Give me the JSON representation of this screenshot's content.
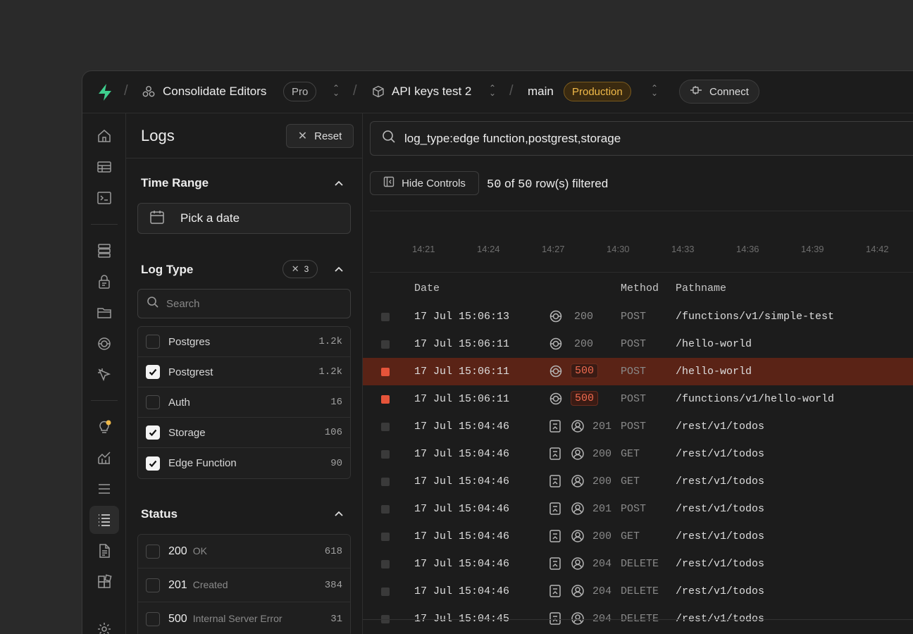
{
  "topbar": {
    "org_name": "Consolidate Editors",
    "plan": "Pro",
    "project_name": "API keys test 2",
    "branch": "main",
    "env": "Production",
    "connect_label": "Connect"
  },
  "panel": {
    "title": "Logs",
    "reset_label": "Reset",
    "time_range_title": "Time Range",
    "date_placeholder": "Pick a date",
    "log_type_title": "Log Type",
    "log_type_selected_count": "3",
    "search_placeholder": "Search",
    "log_types": [
      {
        "label": "Postgres",
        "count": "1.2k",
        "checked": false
      },
      {
        "label": "Postgrest",
        "count": "1.2k",
        "checked": true
      },
      {
        "label": "Auth",
        "count": "16",
        "checked": false
      },
      {
        "label": "Storage",
        "count": "106",
        "checked": true
      },
      {
        "label": "Edge Function",
        "count": "90",
        "checked": true
      }
    ],
    "status_title": "Status",
    "statuses": [
      {
        "code": "200",
        "desc": "OK",
        "count": "618"
      },
      {
        "code": "201",
        "desc": "Created",
        "count": "384"
      },
      {
        "code": "500",
        "desc": "Internal Server Error",
        "count": "31"
      }
    ]
  },
  "main": {
    "query": "log_type:edge function,postgrest,storage",
    "hide_controls_label": "Hide Controls",
    "filtered_count": "50",
    "filtered_total": "50",
    "filtered_of": "of",
    "filtered_suffix": "row(s) filtered",
    "timeline_ticks": [
      "14:21",
      "14:24",
      "14:27",
      "14:30",
      "14:33",
      "14:36",
      "14:39",
      "14:42"
    ],
    "columns": {
      "date": "Date",
      "method": "Method",
      "pathname": "Pathname"
    },
    "rows": [
      {
        "date": "17 Jul 15:06:13",
        "type": "edge",
        "status": "200",
        "method": "POST",
        "path": "/functions/v1/simple-test",
        "level": "ok"
      },
      {
        "date": "17 Jul 15:06:11",
        "type": "edge",
        "status": "200",
        "method": "POST",
        "path": "/hello-world",
        "level": "ok"
      },
      {
        "date": "17 Jul 15:06:11",
        "type": "edge",
        "status": "500",
        "method": "POST",
        "path": "/hello-world",
        "level": "error-selected"
      },
      {
        "date": "17 Jul 15:06:11",
        "type": "edge",
        "status": "500",
        "method": "POST",
        "path": "/functions/v1/hello-world",
        "level": "error"
      },
      {
        "date": "17 Jul 15:04:46",
        "type": "rest",
        "status": "201",
        "method": "POST",
        "path": "/rest/v1/todos",
        "level": "ok"
      },
      {
        "date": "17 Jul 15:04:46",
        "type": "rest",
        "status": "200",
        "method": "GET",
        "path": "/rest/v1/todos",
        "level": "ok"
      },
      {
        "date": "17 Jul 15:04:46",
        "type": "rest",
        "status": "200",
        "method": "GET",
        "path": "/rest/v1/todos",
        "level": "ok"
      },
      {
        "date": "17 Jul 15:04:46",
        "type": "rest",
        "status": "201",
        "method": "POST",
        "path": "/rest/v1/todos",
        "level": "ok"
      },
      {
        "date": "17 Jul 15:04:46",
        "type": "rest",
        "status": "200",
        "method": "GET",
        "path": "/rest/v1/todos",
        "level": "ok"
      },
      {
        "date": "17 Jul 15:04:46",
        "type": "rest",
        "status": "204",
        "method": "DELETE",
        "path": "/rest/v1/todos",
        "level": "ok"
      },
      {
        "date": "17 Jul 15:04:46",
        "type": "rest",
        "status": "204",
        "method": "DELETE",
        "path": "/rest/v1/todos",
        "level": "ok"
      },
      {
        "date": "17 Jul 15:04:45",
        "type": "rest",
        "status": "204",
        "method": "DELETE",
        "path": "/rest/v1/todos",
        "level": "ok"
      }
    ]
  },
  "colors": {
    "brand": "#3ecf8e",
    "error": "#e5543a",
    "warning": "#f0b949"
  },
  "icons": [
    "supabase-logo-icon",
    "org-icon",
    "project-cube-icon",
    "plug-icon",
    "home-icon",
    "table-editor-icon",
    "sql-editor-icon",
    "database-icon",
    "auth-lock-icon",
    "storage-folder-icon",
    "edge-functions-icon",
    "realtime-cursor-icon",
    "advisors-bulb-icon",
    "reports-chart-icon",
    "logs-list-icon",
    "log-explorer-icon",
    "api-docs-icon",
    "integrations-icon",
    "settings-gear-icon"
  ]
}
